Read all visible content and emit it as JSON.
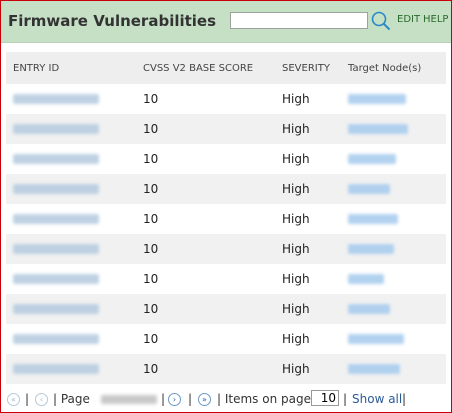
{
  "header": {
    "title": "Firmware Vulnerabilities",
    "search_placeholder": "",
    "edit_label": "EDIT",
    "help_label": "HELP"
  },
  "table": {
    "columns": [
      "ENTRY ID",
      "CVSS V2 BASE SCORE",
      "SEVERITY",
      "Target Node(s)"
    ],
    "rows": [
      {
        "entry_id": "",
        "score": "10",
        "severity": "High",
        "node": ""
      },
      {
        "entry_id": "",
        "score": "10",
        "severity": "High",
        "node": ""
      },
      {
        "entry_id": "",
        "score": "10",
        "severity": "High",
        "node": ""
      },
      {
        "entry_id": "",
        "score": "10",
        "severity": "High",
        "node": ""
      },
      {
        "entry_id": "",
        "score": "10",
        "severity": "High",
        "node": ""
      },
      {
        "entry_id": "",
        "score": "10",
        "severity": "High",
        "node": ""
      },
      {
        "entry_id": "",
        "score": "10",
        "severity": "High",
        "node": ""
      },
      {
        "entry_id": "",
        "score": "10",
        "severity": "High",
        "node": ""
      },
      {
        "entry_id": "",
        "score": "10",
        "severity": "High",
        "node": ""
      },
      {
        "entry_id": "",
        "score": "10",
        "severity": "High",
        "node": ""
      }
    ]
  },
  "pager": {
    "sep1": "|",
    "sep2": "|",
    "page_label": "| Page",
    "sep3": "|",
    "sep4": "|",
    "items_label": "| Items on page",
    "items_value": "10",
    "sep5": "|",
    "show_all": "Show all",
    "sep6": "|"
  }
}
